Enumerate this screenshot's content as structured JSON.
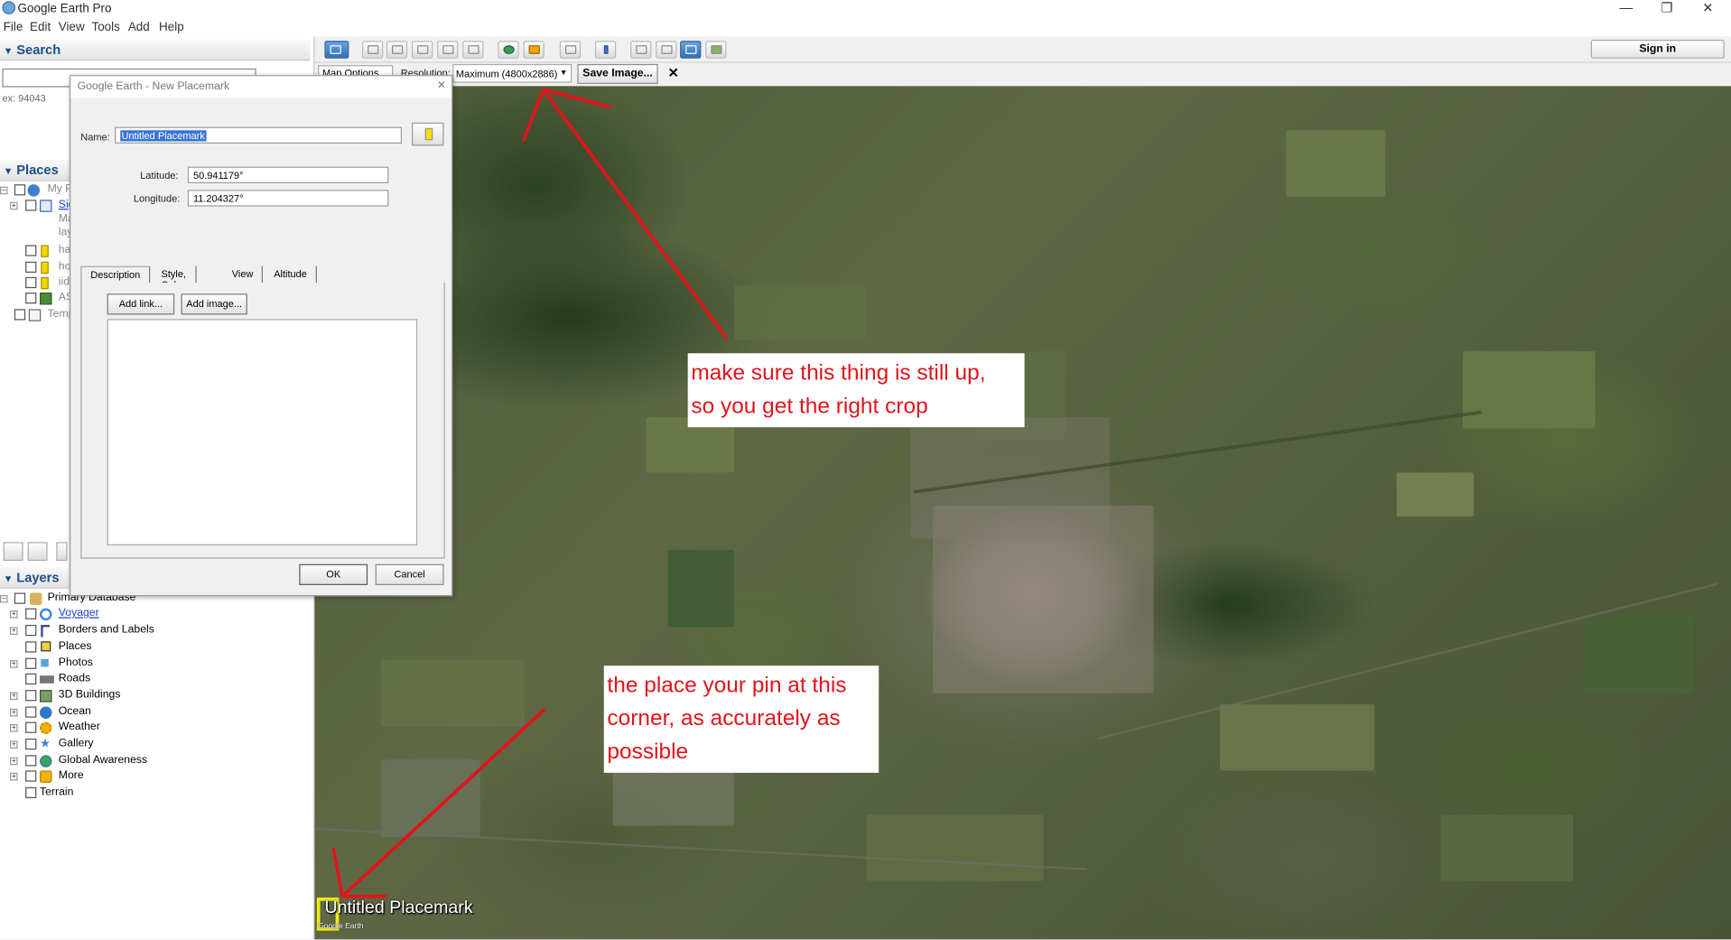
{
  "window": {
    "title": "Google Earth Pro",
    "controls": {
      "minimize": "—",
      "maximize": "❐",
      "close": "✕"
    }
  },
  "menu": [
    "File",
    "Edit",
    "View",
    "Tools",
    "Add",
    "Help"
  ],
  "toolbar": {
    "sign_in": "Sign in"
  },
  "save_image_bar": {
    "map_options": "Map Options...",
    "resolution_label": "Resolution:",
    "resolution_value": "Maximum (4800x2886)",
    "save_button": "Save Image...",
    "close": "✕"
  },
  "sidebar": {
    "search_title": "Search",
    "search_hint": "ex: 94043",
    "places_title": "Places",
    "places_items": [
      {
        "label": "My P",
        "icon": "earth-icon"
      },
      {
        "label": "Sig",
        "icon": "folder-icon",
        "link": true
      },
      {
        "label": "Ma",
        "icon": "none"
      },
      {
        "label": "lay",
        "icon": "none"
      },
      {
        "label": "ha",
        "icon": "pushpin-icon"
      },
      {
        "label": "ho",
        "icon": "pushpin-icon"
      },
      {
        "label": "iid",
        "icon": "pushpin-icon"
      },
      {
        "label": "AS",
        "icon": "image-overlay-icon"
      },
      {
        "label": "Temp",
        "icon": "folder-icon"
      }
    ],
    "layers_title": "Layers",
    "layers": [
      {
        "label": "Primary Database",
        "icon": "database-icon"
      },
      {
        "label": "Voyager",
        "icon": "voyager-icon",
        "link": true
      },
      {
        "label": "Borders and Labels",
        "icon": "borders-icon"
      },
      {
        "label": "Places",
        "icon": "places-icon"
      },
      {
        "label": "Photos",
        "icon": "photos-icon"
      },
      {
        "label": "Roads",
        "icon": "roads-icon"
      },
      {
        "label": "3D Buildings",
        "icon": "buildings-icon"
      },
      {
        "label": "Ocean",
        "icon": "ocean-icon"
      },
      {
        "label": "Weather",
        "icon": "weather-icon"
      },
      {
        "label": "Gallery",
        "icon": "gallery-icon"
      },
      {
        "label": "Global Awareness",
        "icon": "globe-icon"
      },
      {
        "label": "More",
        "icon": "more-icon"
      },
      {
        "label": "Terrain",
        "icon": "none"
      }
    ]
  },
  "dialog": {
    "title": "Google Earth - New Placemark",
    "name_label": "Name:",
    "name_value": "Untitled Placemark",
    "latitude_label": "Latitude:",
    "latitude_value": "50.941179°",
    "longitude_label": "Longitude:",
    "longitude_value": "11.204327°",
    "tabs": [
      "Description",
      "Style, Color",
      "View",
      "Altitude"
    ],
    "add_link": "Add link...",
    "add_image": "Add image...",
    "ok": "OK",
    "cancel": "Cancel"
  },
  "map": {
    "placemark_label": "Untitled Placemark",
    "logo": "Google Earth",
    "callout_top_line1": "make sure this thing is still up,",
    "callout_top_line2": "so you get the right crop",
    "callout_bottom_line1": "the place your pin at this",
    "callout_bottom_line2": "corner, as accurately as",
    "callout_bottom_line3": "possible",
    "annotation_color": "#e1141b"
  }
}
